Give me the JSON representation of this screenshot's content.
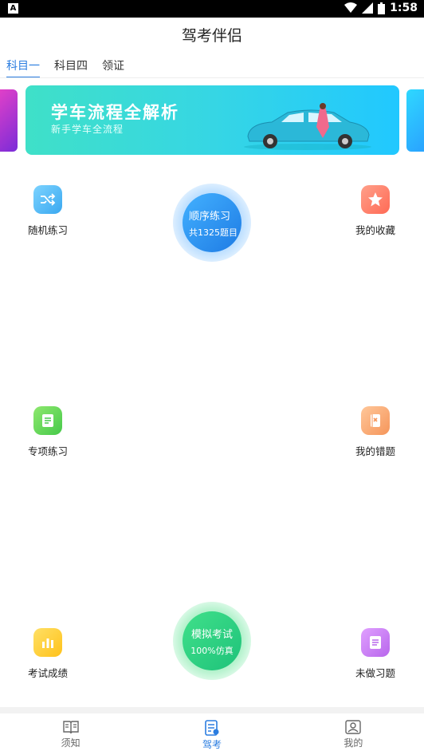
{
  "status_bar": {
    "time": "1:58",
    "left_icon": "A"
  },
  "app_title": "驾考伴侣",
  "tabs": [
    {
      "label": "科目一",
      "active": true
    },
    {
      "label": "科目四",
      "active": false
    },
    {
      "label": "领证",
      "active": false
    }
  ],
  "banner": {
    "title": "学车流程全解析",
    "subtitle": "新手学车全流程"
  },
  "features": {
    "random": {
      "label": "随机练习",
      "icon": "shuffle-icon",
      "color": "#4fb6f5"
    },
    "favorites": {
      "label": "我的收藏",
      "icon": "star-icon",
      "color": "#ff7a5c"
    },
    "special": {
      "label": "专项练习",
      "icon": "document-icon",
      "color": "#5cd55a"
    },
    "mistakes": {
      "label": "我的错题",
      "icon": "notebook-x-icon",
      "color": "#f5a56a"
    },
    "scores": {
      "label": "考试成绩",
      "icon": "bar-chart-icon",
      "color": "#ffcc2e"
    },
    "undone": {
      "label": "未做习题",
      "icon": "list-doc-icon",
      "color": "#c77af0"
    }
  },
  "sequential": {
    "title": "顺序练习",
    "subtitle": "共1325题目"
  },
  "mock_exam": {
    "title": "模拟考试",
    "subtitle": "100%仿真"
  },
  "bottom_nav": [
    {
      "label": "须知",
      "icon": "book-icon",
      "active": false
    },
    {
      "label": "驾考",
      "icon": "license-icon",
      "active": true
    },
    {
      "label": "我的",
      "icon": "profile-icon",
      "active": false
    }
  ]
}
